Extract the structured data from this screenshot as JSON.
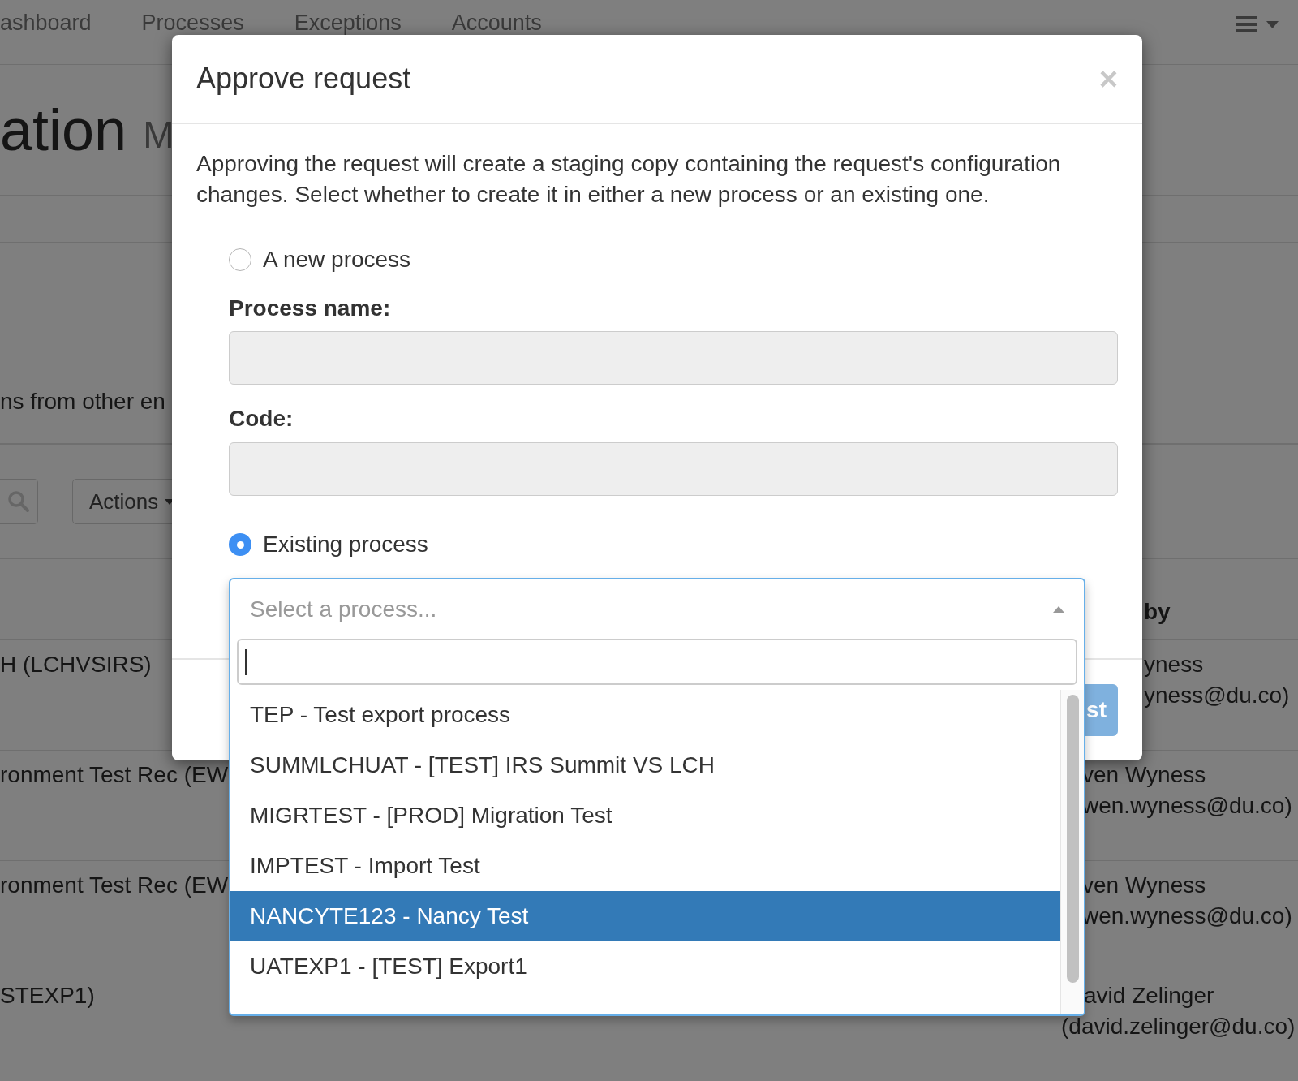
{
  "nav": {
    "items": [
      "ashboard",
      "Processes",
      "Exceptions",
      "Accounts"
    ]
  },
  "page": {
    "title": "ation",
    "subtitle": "M",
    "description": "ns from other en",
    "actions_button": "Actions",
    "table": {
      "header": "by",
      "rows": [
        {
          "column_1": "H (LCHVSIRS)",
          "name": "yness",
          "email": "yness@du.co)"
        },
        {
          "column_1": "ronment Test Rec (EW",
          "name": "ven Wyness",
          "email": "wen.wyness@du.co)"
        },
        {
          "column_1": "ronment Test Rec (EW",
          "name": "ven Wyness",
          "email": "wen.wyness@du.co)"
        },
        {
          "column_1": "STEXP1)",
          "name": "avid Zelinger",
          "email": "(david.zelinger@du.co)"
        }
      ]
    }
  },
  "modal": {
    "title": "Approve request",
    "close": "×",
    "intro": "Approving the request will create a staging copy containing the request's configuration changes. Select whether to create it in either a new process or an existing one.",
    "options": [
      {
        "label": "A new process",
        "selected": false
      },
      {
        "label": "Existing process",
        "selected": true
      }
    ],
    "fields": [
      {
        "label": "Process name:",
        "disabled": true
      },
      {
        "label": "Code:",
        "disabled": true
      }
    ],
    "select": {
      "placeholder": "Select a process...",
      "options": [
        {
          "label": "TEP - Test export process",
          "selected": false
        },
        {
          "label": "SUMMLCHUAT - [TEST] IRS Summit VS LCH",
          "selected": false
        },
        {
          "label": "MIGRTEST - [PROD] Migration Test",
          "selected": false
        },
        {
          "label": "IMPTEST - Import Test",
          "selected": false
        },
        {
          "label": "NANCYTE123 - Nancy Test",
          "selected": true
        },
        {
          "label": "UATEXP1 - [TEST] Export1",
          "selected": false
        }
      ]
    },
    "footer_button": "st"
  }
}
